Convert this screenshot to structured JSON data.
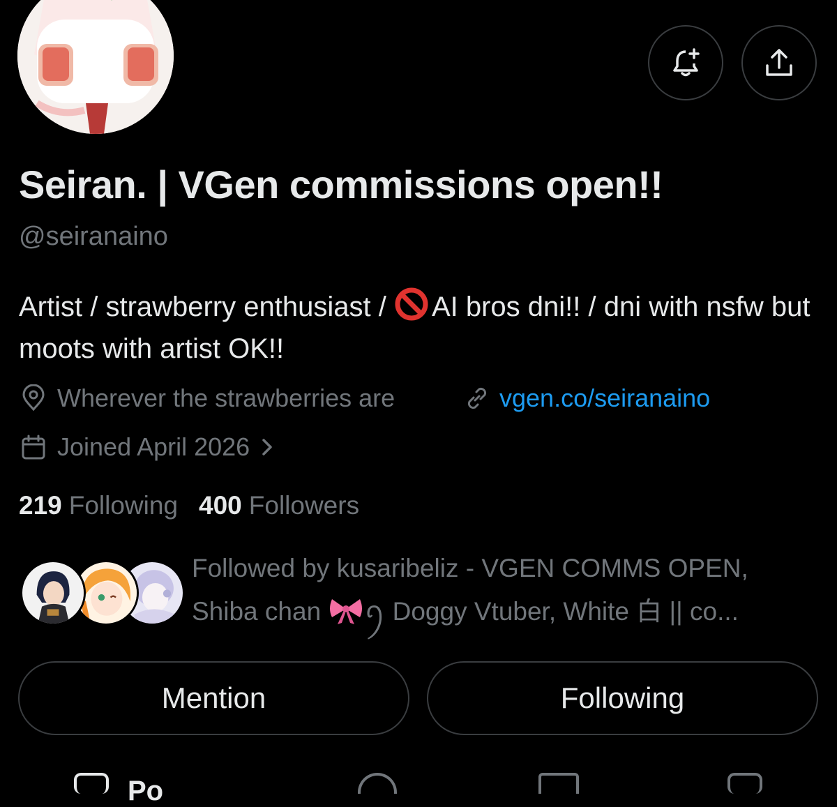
{
  "profile": {
    "display_name": "Seiran. | VGen commissions open!!",
    "handle": "@seiranaino",
    "bio_before_emoji": "Artist / strawberry enthusiast / ",
    "bio_emoji_icon": "prohibited-icon",
    "bio_after_emoji": "AI bros dni!! / dni with nsfw but moots with artist OK!!",
    "location": "Wherever the strawberries are",
    "link": "vgen.co/seiranaino",
    "joined": "Joined April 2026"
  },
  "stats": {
    "following_count": "219",
    "following_label": "Following",
    "followers_count": "400",
    "followers_label": "Followers"
  },
  "followed_by": {
    "text_part1": "Followed by kusaribeliz - VGEN COMMS OPEN, Shiba chan ",
    "bow_icon": "ribbon-bow-icon",
    "text_part2": "ꪆ Doggy Vtuber, White 白 || co..."
  },
  "actions": {
    "mention_label": "Mention",
    "following_label": "Following"
  },
  "tabs": {
    "first_partial_label": "Po"
  },
  "colors": {
    "background": "#000000",
    "primary_text": "#e7e9ea",
    "secondary_text": "#71767b",
    "link": "#1d9bf0",
    "border": "#3a3d40"
  }
}
